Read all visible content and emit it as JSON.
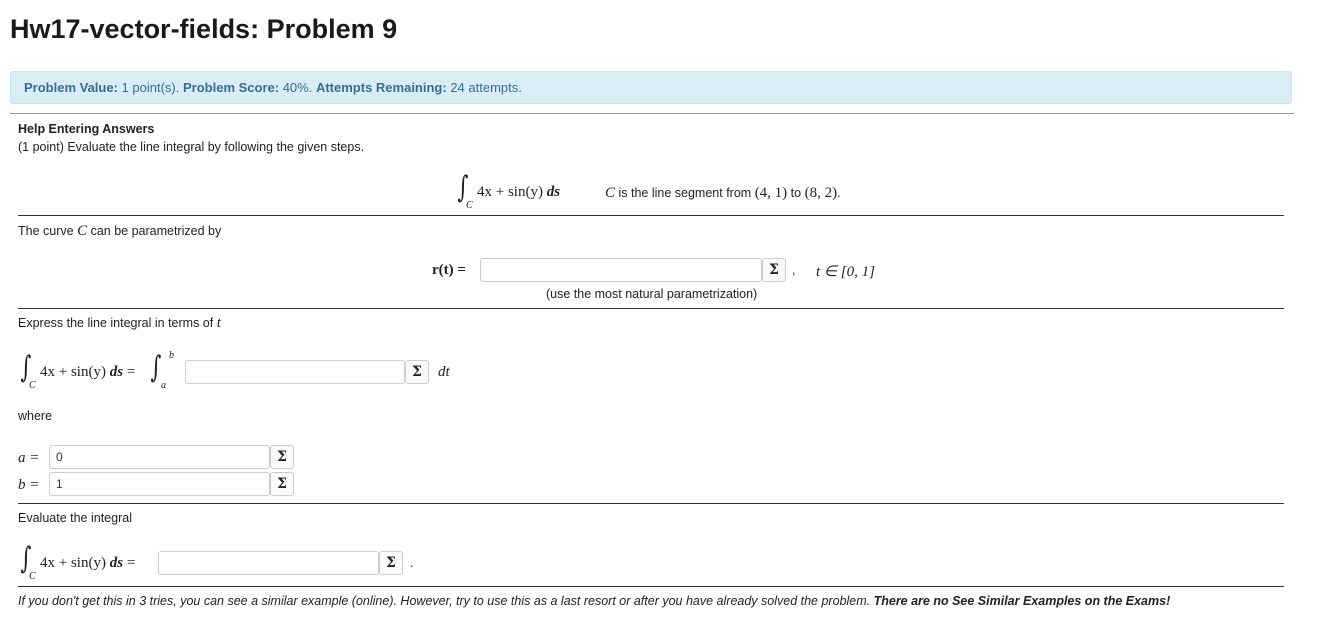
{
  "page": {
    "title": "Hw17-vector-fields: Problem 9"
  },
  "info": {
    "value_label": "Problem Value:",
    "value_text": "1 point(s).",
    "score_label": "Problem Score:",
    "score_text": "40%.",
    "attempts_label": "Attempts Remaining:",
    "attempts_text": "24 attempts."
  },
  "problem": {
    "help_link": "Help Entering Answers",
    "intro": "(1 point) Evaluate the line integral by following the given steps.",
    "integrand": "4x + sin(y)",
    "ds": "ds",
    "curve_var": "C",
    "segment_text": "is the line segment from",
    "point1": "(4, 1)",
    "to_text": "to",
    "point2": "(8, 2)",
    "period": "."
  },
  "step1": {
    "label_pre": "The curve",
    "label_var": "C",
    "label_post": "can be parametrized by",
    "lhs": "r(t) =",
    "answer_value": "",
    "comma": ",",
    "domain": "t ∈ [0, 1]",
    "hint": "(use the most natural parametrization)"
  },
  "step2": {
    "label": "Express the line integral in terms of",
    "label_var": "t",
    "equals": "=",
    "lower": "a",
    "upper": "b",
    "answer_value": "",
    "dt": "dt",
    "where": "where",
    "a_label": "a =",
    "a_value": "0",
    "b_label": "b =",
    "b_value": "1"
  },
  "step3": {
    "label": "Evaluate the integral",
    "equals": "=",
    "answer_value": "",
    "period": "."
  },
  "footer": {
    "note": "If you don't get this in 3 tries, you can see a similar example (online). However, try to use this as a last resort or after you have already solved the problem.",
    "bold_note": "There are no See Similar Examples on the Exams!"
  },
  "icons": {
    "equation_editor": "Σ"
  },
  "colors": {
    "info_bg": "#d9edf7",
    "info_text": "#31708f"
  }
}
